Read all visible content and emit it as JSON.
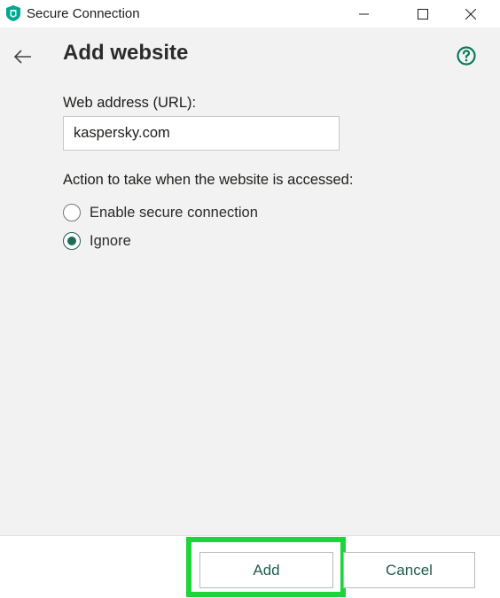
{
  "window": {
    "title": "Secure Connection",
    "app_icon": "kaspersky-shield-icon",
    "controls": [
      "minimize-icon",
      "maximize-icon",
      "close-icon"
    ]
  },
  "header": {
    "back_icon": "back-arrow-icon",
    "title": "Add website",
    "help_icon": "help-icon"
  },
  "form": {
    "url_label": "Web address (URL):",
    "url_value": "kaspersky.com",
    "action_label": "Action to take when the website is accessed:",
    "options": [
      {
        "label": "Enable secure connection",
        "selected": false
      },
      {
        "label": "Ignore",
        "selected": true
      }
    ]
  },
  "footer": {
    "add_label": "Add",
    "cancel_label": "Cancel"
  },
  "colors": {
    "accent": "#1f6b57",
    "help_icon": "#0a7a5b",
    "highlight": "#1fd43b",
    "background": "#f2f2f2"
  }
}
